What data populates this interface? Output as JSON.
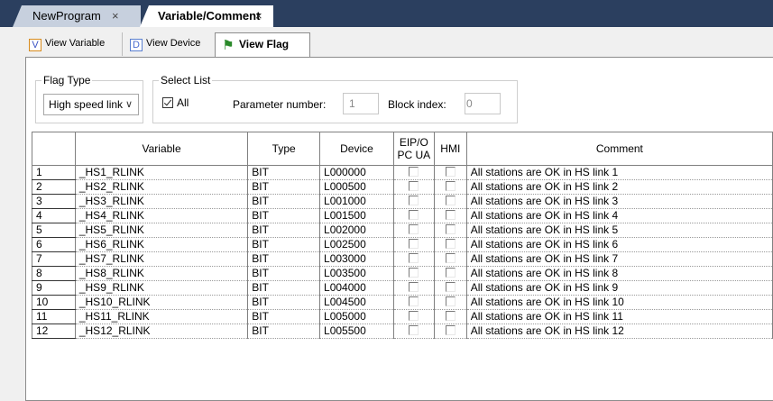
{
  "tabs": [
    {
      "label": "NewProgram",
      "close": "×"
    },
    {
      "label": "Variable/Comment",
      "close": "×"
    }
  ],
  "views": [
    {
      "label": "View Variable",
      "icon": "V"
    },
    {
      "label": "View Device",
      "icon": "D"
    },
    {
      "label": "View Flag",
      "icon": "flag-icon"
    }
  ],
  "flag_type": {
    "legend": "Flag Type",
    "value": "High speed link"
  },
  "select_list": {
    "legend": "Select List",
    "all_label": "All",
    "all_checked": true,
    "param_label": "Parameter number:",
    "param_value": "1",
    "block_label": "Block index:",
    "block_value": "0"
  },
  "columns": [
    "",
    "Variable",
    "Type",
    "Device",
    "EIP/O PC UA",
    "HMI",
    "Comment"
  ],
  "rows": [
    {
      "n": "1",
      "variable": "_HS1_RLINK",
      "type": "BIT",
      "device": "L000000",
      "comment": "All stations are OK in HS link 1"
    },
    {
      "n": "2",
      "variable": "_HS2_RLINK",
      "type": "BIT",
      "device": "L000500",
      "comment": "All stations are OK in HS link 2"
    },
    {
      "n": "3",
      "variable": "_HS3_RLINK",
      "type": "BIT",
      "device": "L001000",
      "comment": "All stations are OK in HS link 3"
    },
    {
      "n": "4",
      "variable": "_HS4_RLINK",
      "type": "BIT",
      "device": "L001500",
      "comment": "All stations are OK in HS link 4"
    },
    {
      "n": "5",
      "variable": "_HS5_RLINK",
      "type": "BIT",
      "device": "L002000",
      "comment": "All stations are OK in HS link 5"
    },
    {
      "n": "6",
      "variable": "_HS6_RLINK",
      "type": "BIT",
      "device": "L002500",
      "comment": "All stations are OK in HS link 6"
    },
    {
      "n": "7",
      "variable": "_HS7_RLINK",
      "type": "BIT",
      "device": "L003000",
      "comment": "All stations are OK in HS link 7"
    },
    {
      "n": "8",
      "variable": "_HS8_RLINK",
      "type": "BIT",
      "device": "L003500",
      "comment": "All stations are OK in HS link 8"
    },
    {
      "n": "9",
      "variable": "_HS9_RLINK",
      "type": "BIT",
      "device": "L004000",
      "comment": "All stations are OK in HS link 9"
    },
    {
      "n": "10",
      "variable": "_HS10_RLINK",
      "type": "BIT",
      "device": "L004500",
      "comment": "All stations are OK in HS link 10"
    },
    {
      "n": "11",
      "variable": "_HS11_RLINK",
      "type": "BIT",
      "device": "L005000",
      "comment": "All stations are OK in HS link 11"
    },
    {
      "n": "12",
      "variable": "_HS12_RLINK",
      "type": "BIT",
      "device": "L005500",
      "comment": "All stations are OK in HS link 12"
    }
  ]
}
